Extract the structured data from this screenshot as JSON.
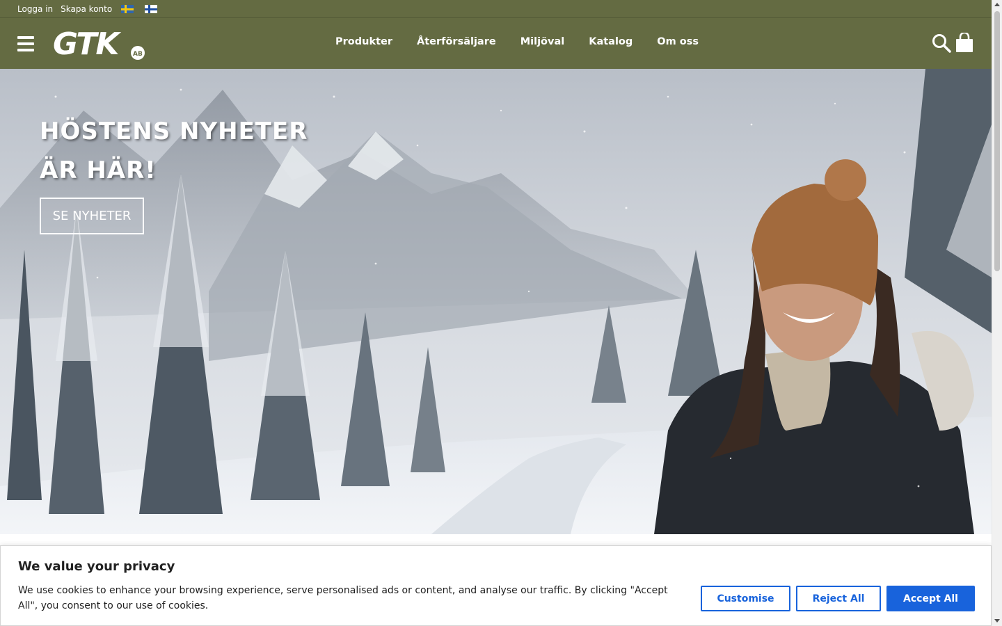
{
  "topbar": {
    "login": "Logga in",
    "register": "Skapa konto",
    "flags": [
      "swedish-flag",
      "finnish-flag"
    ]
  },
  "header": {
    "logo_text": "GTK",
    "logo_sub": "AB",
    "nav": [
      "Produkter",
      "Återförsäljare",
      "Miljöval",
      "Katalog",
      "Om oss"
    ],
    "icons": [
      "menu-icon",
      "search-icon",
      "shopping-bag-icon"
    ]
  },
  "hero": {
    "title_line1": "HÖSTENS NYHETER",
    "title_line2": "ÄR HÄR!",
    "button": "SE NYHETER"
  },
  "cookie": {
    "title": "We value your privacy",
    "text": "We use cookies to enhance your browsing experience, serve personalised ads or content, and analyse our traffic. By clicking \"Accept All\", you consent to our use of cookies.",
    "customise": "Customise",
    "reject": "Reject All",
    "accept": "Accept All"
  },
  "colors": {
    "header_bg": "#646b42",
    "cookie_accent": "#1863dc"
  }
}
